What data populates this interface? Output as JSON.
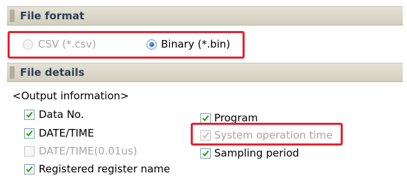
{
  "file_format": {
    "title": "File format",
    "options": [
      {
        "label": "CSV (*.csv)",
        "selected": false,
        "enabled": false
      },
      {
        "label": "Binary (*.bin)",
        "selected": true,
        "enabled": true
      }
    ]
  },
  "file_details": {
    "title": "File details",
    "output_heading": "<Output information>",
    "checkboxes": [
      {
        "label": "Data No.",
        "checked": true,
        "enabled": true
      },
      {
        "label": "DATE/TIME",
        "checked": true,
        "enabled": true
      },
      {
        "label": "DATE/TIME(0.01us)",
        "checked": false,
        "enabled": false
      },
      {
        "label": "Registered register name",
        "checked": true,
        "enabled": true
      },
      {
        "label": "Program",
        "checked": true,
        "enabled": true
      },
      {
        "label": "System operation time",
        "checked": true,
        "enabled": false
      },
      {
        "label": "Sampling period",
        "checked": true,
        "enabled": true
      }
    ]
  },
  "colors": {
    "highlight_red": "#e8202f",
    "header_text": "#2d3e55",
    "check_mark": "#21a121",
    "disabled_text": "#a6a6a6"
  },
  "icons": [
    "checkbox-checked",
    "checkbox-unchecked",
    "radio-selected",
    "radio-unselected"
  ]
}
